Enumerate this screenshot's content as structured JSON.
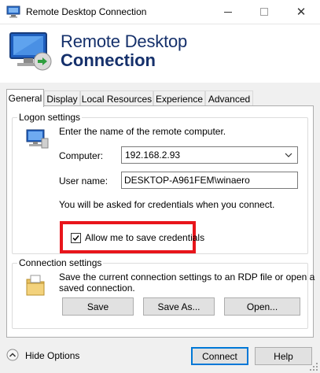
{
  "window": {
    "title": "Remote Desktop Connection",
    "controls": {
      "minimize": "minimize-icon",
      "maximize": "maximize-icon",
      "close": "close-icon"
    }
  },
  "banner": {
    "line1": "Remote Desktop",
    "line2": "Connection"
  },
  "tabs": [
    {
      "label": "General",
      "active": true
    },
    {
      "label": "Display",
      "active": false
    },
    {
      "label": "Local Resources",
      "active": false
    },
    {
      "label": "Experience",
      "active": false
    },
    {
      "label": "Advanced",
      "active": false
    }
  ],
  "logon": {
    "group_label": "Logon settings",
    "instruction": "Enter the name of the remote computer.",
    "computer_label": "Computer:",
    "computer_value": "192.168.2.93",
    "username_label": "User name:",
    "username_value": "DESKTOP-A961FEM\\winaero",
    "credentials_note": "You will be asked for credentials when you connect.",
    "save_credentials_label": "Allow me to save credentials",
    "save_credentials_checked": true
  },
  "connection": {
    "group_label": "Connection settings",
    "description_line1": "Save the current connection settings to an RDP file or open a",
    "description_line2": "saved connection.",
    "save_label": "Save",
    "save_as_label": "Save As...",
    "open_label": "Open..."
  },
  "footer": {
    "hide_options_label": "Hide Options",
    "connect_label": "Connect",
    "help_label": "Help"
  },
  "colors": {
    "accent": "#0078d7",
    "highlight_box": "#e8151b",
    "banner_text": "#15306b"
  }
}
